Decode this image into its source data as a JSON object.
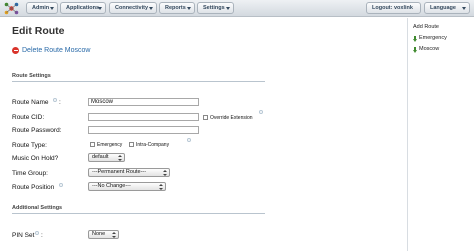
{
  "nav": {
    "admin": "Admin",
    "applications": "Applications",
    "connectivity": "Connectivity",
    "reports": "Reports",
    "settings": "Settings",
    "logout": "Logout: voxlink",
    "language": "Language"
  },
  "page": {
    "title": "Edit Route",
    "delete_link": "Delete Route Moscow"
  },
  "sections": {
    "route_settings": "Route Settings",
    "additional_settings": "Additional Settings"
  },
  "form": {
    "route_name": {
      "label": "Route Name",
      "value": "Moscow"
    },
    "route_cid": {
      "label": "Route CID:",
      "value": "",
      "override_label": "Override Extension",
      "override_checked": false
    },
    "route_password": {
      "label": "Route Password:",
      "value": ""
    },
    "route_type": {
      "label": "Route Type:",
      "emergency_label": "Emergency",
      "intra_company_label": "Intra-Company"
    },
    "music_on_hold": {
      "label": "Music On Hold?",
      "selected": "default"
    },
    "time_group": {
      "label": "Time Group:",
      "selected": "---Permanent Route---"
    },
    "route_position": {
      "label": "Route Position",
      "selected": "---No Change---"
    },
    "pin_set": {
      "label": "PIN Set",
      "selected": "None"
    }
  },
  "sidebar": {
    "add_route": "Add Route",
    "items": [
      "Emergency",
      "Moscow"
    ]
  },
  "colors": {
    "link": "#2a6aa8",
    "delete": "#d9342b",
    "arrow": "#3f8a2e"
  }
}
